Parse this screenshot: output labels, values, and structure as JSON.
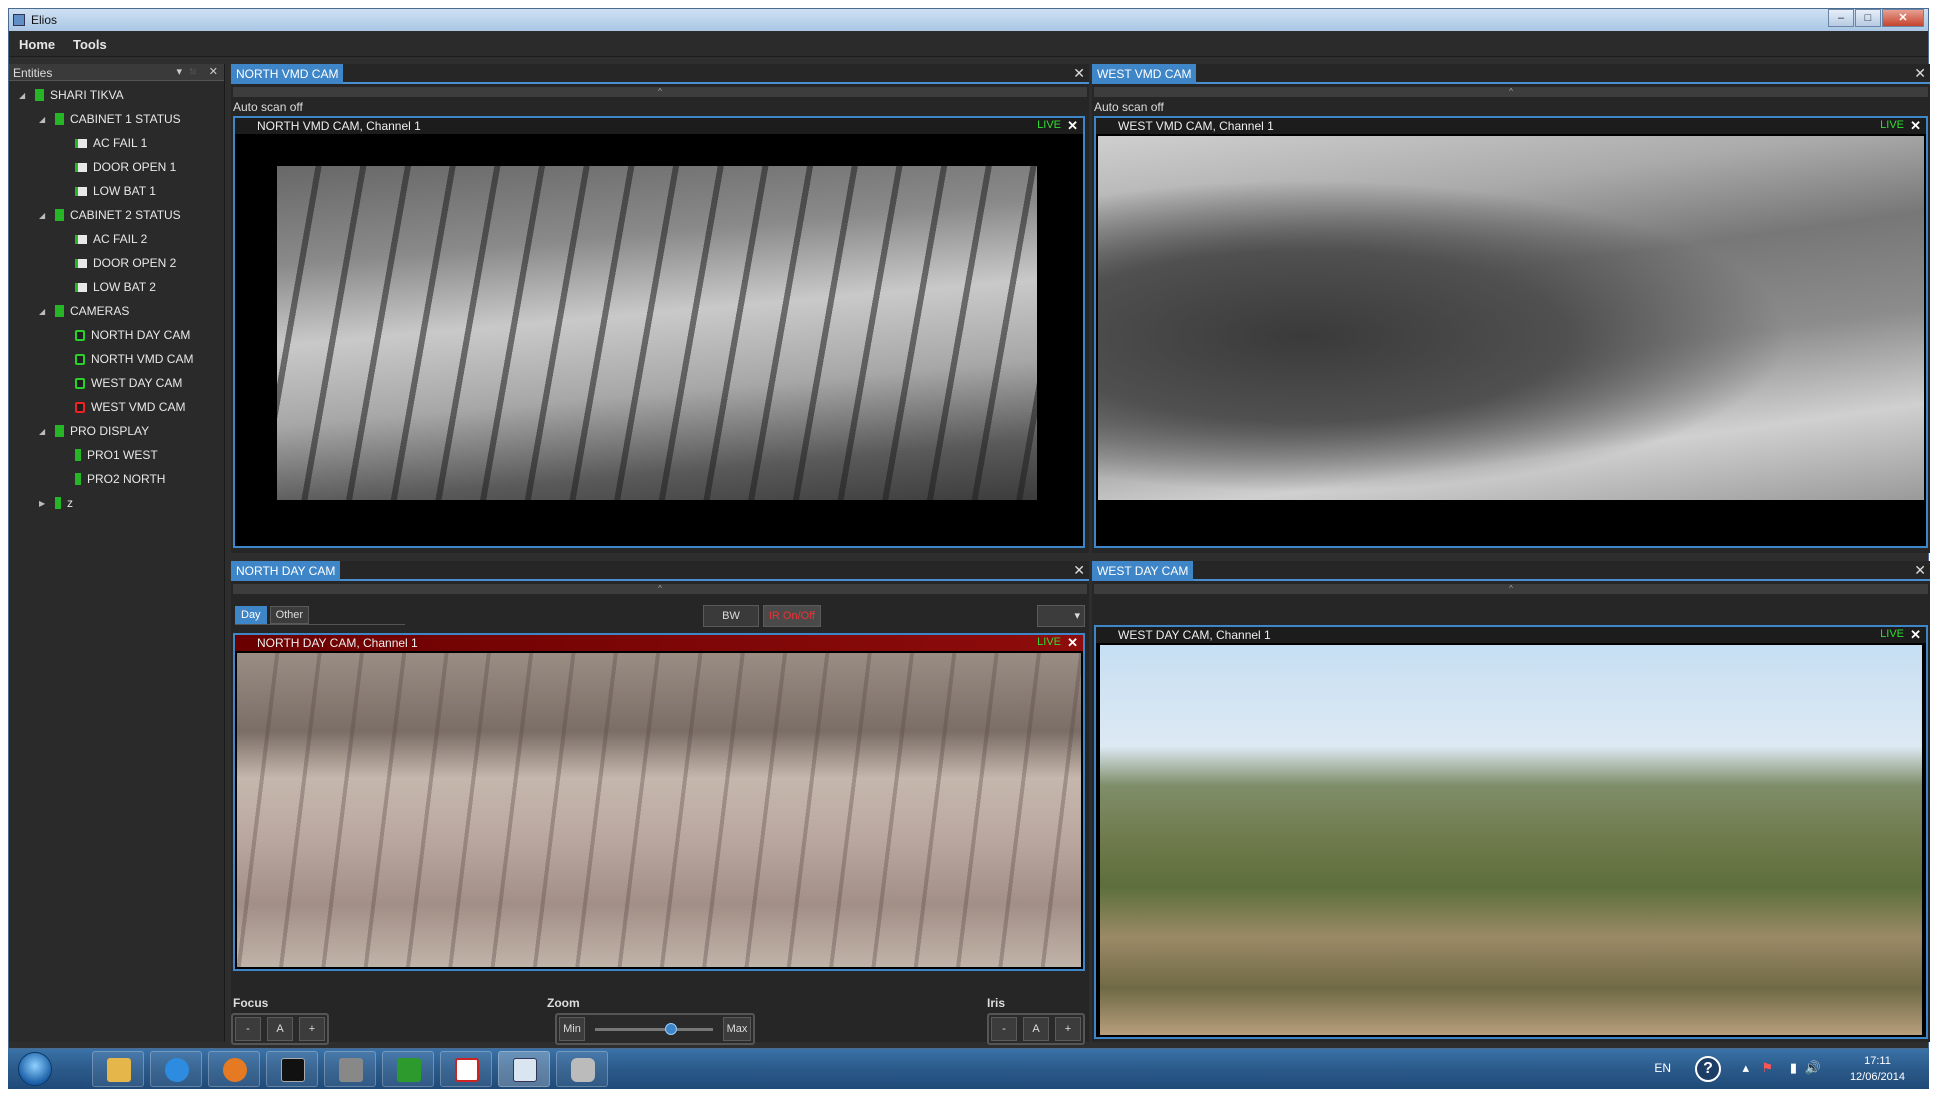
{
  "window": {
    "title": "Elios"
  },
  "window_controls": {
    "minimize": "–",
    "maximize": "□",
    "close": "✕"
  },
  "menu": {
    "items": [
      "Home",
      "Tools"
    ]
  },
  "sidebar": {
    "header": "Entities",
    "header_controls": {
      "dropdown": "▾",
      "pin": "◾",
      "close": "✕"
    },
    "tree": [
      {
        "label": "SHARI TIKVA",
        "level": 0,
        "icon": "group",
        "expander": "◢"
      },
      {
        "label": "CABINET 1 STATUS",
        "level": 1,
        "icon": "group",
        "expander": "◢"
      },
      {
        "label": "AC FAIL 1",
        "level": 2,
        "icon": "sensor",
        "expander": ""
      },
      {
        "label": "DOOR OPEN 1",
        "level": 2,
        "icon": "sensor",
        "expander": ""
      },
      {
        "label": "LOW BAT 1",
        "level": 2,
        "icon": "sensor",
        "expander": ""
      },
      {
        "label": "CABINET 2 STATUS",
        "level": 1,
        "icon": "group",
        "expander": "◢"
      },
      {
        "label": "AC FAIL 2",
        "level": 2,
        "icon": "sensor",
        "expander": ""
      },
      {
        "label": "DOOR OPEN 2",
        "level": 2,
        "icon": "sensor",
        "expander": ""
      },
      {
        "label": "LOW BAT 2",
        "level": 2,
        "icon": "sensor",
        "expander": ""
      },
      {
        "label": "CAMERAS",
        "level": 1,
        "icon": "group",
        "expander": "◢"
      },
      {
        "label": "NORTH DAY CAM",
        "level": 2,
        "icon": "cam",
        "expander": ""
      },
      {
        "label": "NORTH VMD CAM",
        "level": 2,
        "icon": "cam",
        "expander": ""
      },
      {
        "label": "WEST DAY CAM",
        "level": 2,
        "icon": "cam",
        "expander": ""
      },
      {
        "label": "WEST VMD CAM",
        "level": 2,
        "icon": "cam-alert",
        "expander": ""
      },
      {
        "label": "PRO DISPLAY",
        "level": 1,
        "icon": "group",
        "expander": "◢"
      },
      {
        "label": "PRO1 WEST",
        "level": 2,
        "icon": "bar",
        "expander": ""
      },
      {
        "label": "PRO2 NORTH",
        "level": 2,
        "icon": "bar",
        "expander": ""
      },
      {
        "label": "z",
        "level": 1,
        "icon": "bar",
        "expander": "▶"
      }
    ]
  },
  "panels": {
    "north_vmd": {
      "tab": "NORTH VMD CAM",
      "close": "✕",
      "collapse": "^",
      "scan": "Auto scan off",
      "video": {
        "title": "NORTH VMD CAM, Channel  1",
        "live": "LIVE",
        "close": "✕"
      }
    },
    "west_vmd": {
      "tab": "WEST VMD CAM",
      "close": "✕",
      "collapse": "^",
      "scan": "Auto scan off",
      "video": {
        "title": "WEST VMD CAM, Channel  1",
        "live": "LIVE",
        "close": "✕"
      }
    },
    "north_day": {
      "tab": "NORTH DAY CAM",
      "close": "✕",
      "collapse": "^",
      "mode_tabs": [
        "Day",
        "Other"
      ],
      "bw_button": "BW",
      "ir_button": "IR On/Off",
      "dropdown": "▾",
      "video": {
        "title": "NORTH DAY CAM, Channel  1",
        "live": "LIVE",
        "close": "✕"
      },
      "focus": {
        "label": "Focus",
        "minus": "-",
        "auto": "A",
        "plus": "+"
      },
      "zoom": {
        "label": "Zoom",
        "min": "Min",
        "max": "Max",
        "level": 0.65
      },
      "iris": {
        "label": "Iris",
        "minus": "-",
        "auto": "A",
        "plus": "+"
      }
    },
    "west_day": {
      "tab": "WEST DAY CAM",
      "close": "✕",
      "collapse": "^",
      "video": {
        "title": "WEST DAY CAM, Channel  1",
        "live": "LIVE",
        "close": "✕"
      }
    }
  },
  "taskbar": {
    "tray": {
      "lang": "EN",
      "help": "?",
      "time": "17:11",
      "date": "12/06/2014",
      "arrow": "▴",
      "flag": "⚑",
      "signal": "▮",
      "volume": "🔊"
    }
  },
  "colors": {
    "accent": "#3f86c8",
    "live": "#33dd33",
    "status_green": "#26b526",
    "alert_red": "#e22222"
  }
}
